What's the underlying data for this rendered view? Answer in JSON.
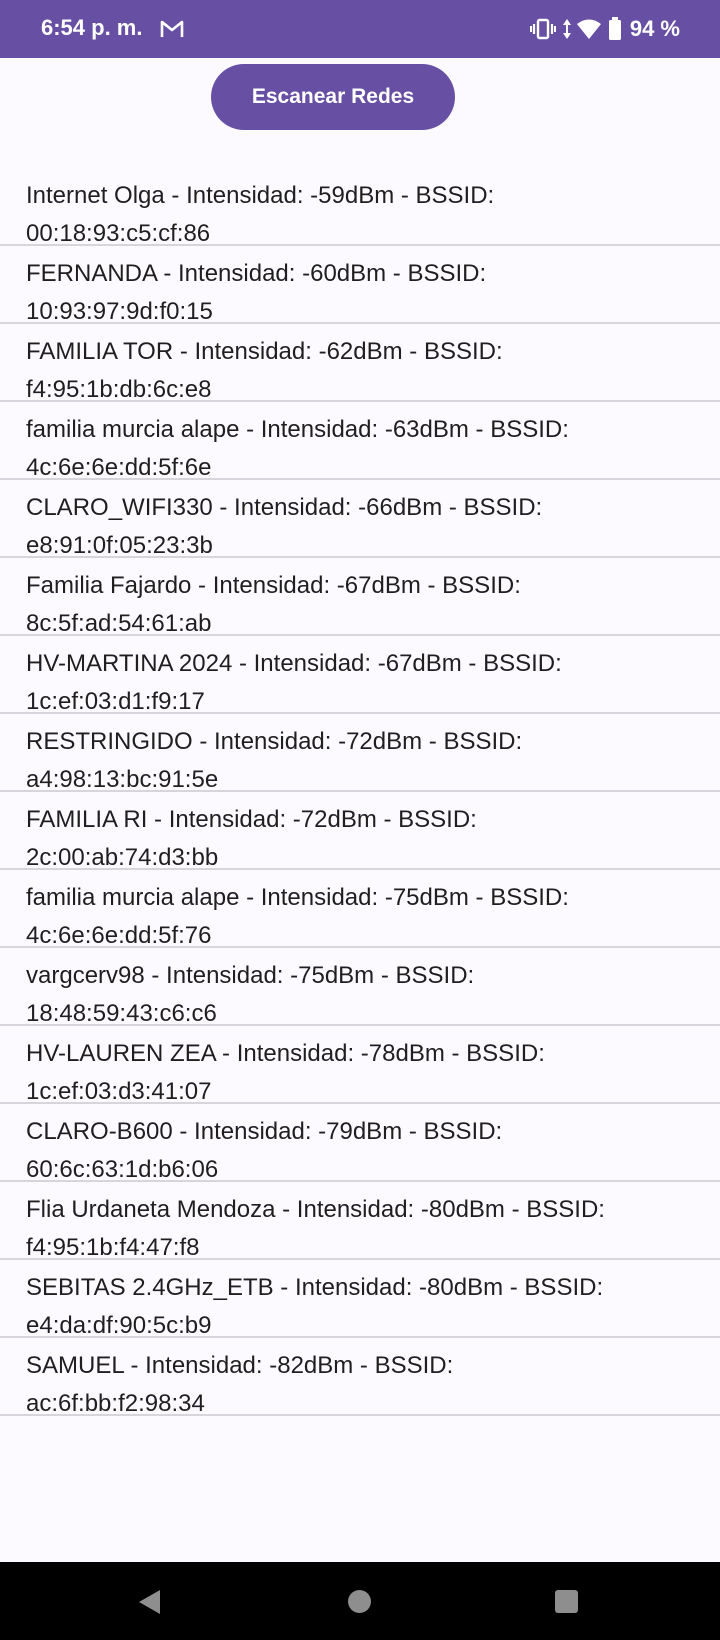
{
  "status_bar": {
    "time": "6:54 p. m.",
    "battery_percent": "94 %",
    "icons": [
      "gmail-icon",
      "vibrate-icon",
      "data-arrows-icon",
      "wifi-icon",
      "battery-icon"
    ]
  },
  "scan_button": {
    "label": "Escanear Redes"
  },
  "networks": [
    {
      "line1": "Internet Olga - Intensidad: -59dBm - BSSID:",
      "line2": "00:18:93:c5:cf:86"
    },
    {
      "line1": "FERNANDA - Intensidad: -60dBm - BSSID:",
      "line2": "10:93:97:9d:f0:15"
    },
    {
      "line1": "FAMILIA TOR - Intensidad: -62dBm - BSSID:",
      "line2": "f4:95:1b:db:6c:e8"
    },
    {
      "line1": "familia murcia alape - Intensidad: -63dBm - BSSID:",
      "line2": "4c:6e:6e:dd:5f:6e"
    },
    {
      "line1": "CLARO_WIFI330 - Intensidad: -66dBm - BSSID:",
      "line2": "e8:91:0f:05:23:3b"
    },
    {
      "line1": "Familia Fajardo - Intensidad: -67dBm - BSSID:",
      "line2": "8c:5f:ad:54:61:ab"
    },
    {
      "line1": "HV-MARTINA 2024 - Intensidad: -67dBm - BSSID:",
      "line2": "1c:ef:03:d1:f9:17"
    },
    {
      "line1": "RESTRINGIDO - Intensidad: -72dBm - BSSID:",
      "line2": "a4:98:13:bc:91:5e"
    },
    {
      "line1": "FAMILIA RI - Intensidad: -72dBm - BSSID:",
      "line2": "2c:00:ab:74:d3:bb"
    },
    {
      "line1": "familia murcia alape - Intensidad: -75dBm - BSSID:",
      "line2": "4c:6e:6e:dd:5f:76"
    },
    {
      "line1": "vargcerv98 - Intensidad: -75dBm - BSSID:",
      "line2": "18:48:59:43:c6:c6"
    },
    {
      "line1": "HV-LAUREN ZEA - Intensidad: -78dBm - BSSID:",
      "line2": "1c:ef:03:d3:41:07"
    },
    {
      "line1": "CLARO-B600 - Intensidad: -79dBm - BSSID:",
      "line2": "60:6c:63:1d:b6:06"
    },
    {
      "line1": "Flia Urdaneta Mendoza  - Intensidad: -80dBm - BSSID:",
      "line2": "f4:95:1b:f4:47:f8"
    },
    {
      "line1": "SEBITAS 2.4GHz_ETB - Intensidad: -80dBm - BSSID:",
      "line2": "e4:da:df:90:5c:b9"
    },
    {
      "line1": "SAMUEL - Intensidad: -82dBm - BSSID:",
      "line2": "ac:6f:bb:f2:98:34"
    }
  ],
  "nav_bar": {
    "icons": [
      "back-icon",
      "home-icon",
      "recents-icon"
    ]
  },
  "colors": {
    "accent": "#6750a4",
    "background": "#fcfaff",
    "divider": "#d7d5dc",
    "nav": "#000000"
  }
}
